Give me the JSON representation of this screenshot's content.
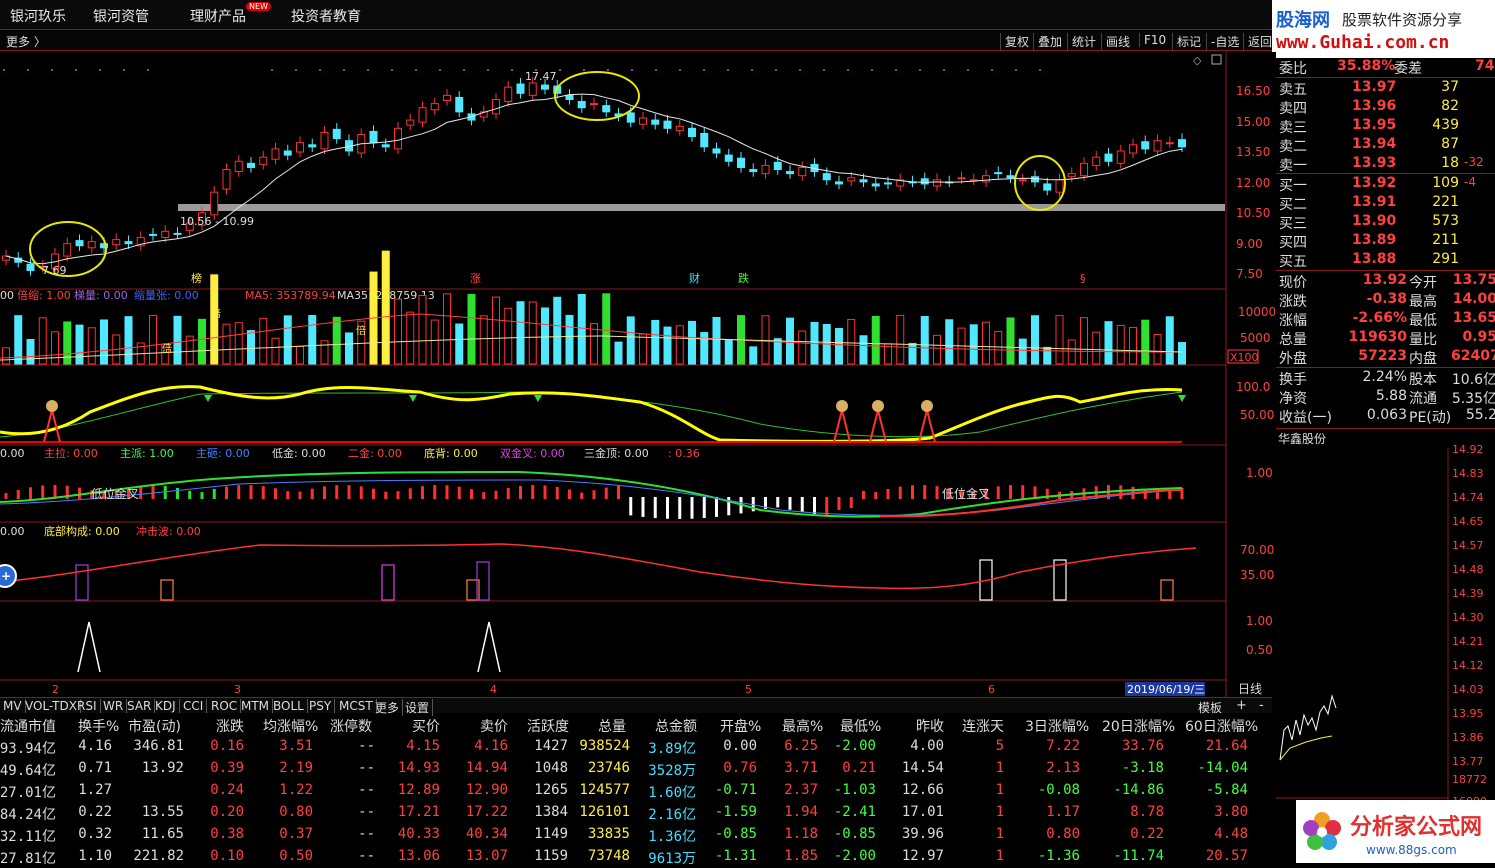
{
  "nav": {
    "items": [
      "银河玖乐",
      "银河资管",
      "理财产品",
      "投资者教育"
    ],
    "new_badge": "NEW"
  },
  "watermark": {
    "brand": "股海网",
    "slogan": "股票软件资源分享",
    "url": "www.Guhai.com.cn"
  },
  "toolbar": {
    "more": "更多 〉",
    "buttons": [
      "复权",
      "叠加",
      "统计",
      "画线",
      "F10",
      "标记",
      "-自选",
      "返回"
    ]
  },
  "chart": {
    "price_axis": [
      "16.50",
      "15.00",
      "13.50",
      "12.00",
      "10.50",
      "9.00",
      "7.50"
    ],
    "annotations": {
      "high": "17.47",
      "low": "7.69",
      "range": "10.56 - 10.99"
    },
    "event_marks": [
      "榜",
      "涨",
      "财",
      "跌",
      "§"
    ],
    "volume_legend": {
      "prefix": "00",
      "bei_label": "倍缩: 1.00",
      "ti_label": "梯量: 0.00",
      "suo_label": "缩量张: 0.00",
      "ma5": "MA5: 353789.94",
      "ma35": "MA35: 268759.13"
    },
    "volume_axis": [
      "10000",
      "5000",
      "X100"
    ],
    "vol_bar_label": "倍",
    "osc_axis": [
      "100.0",
      "50.00"
    ],
    "ind3_legend": [
      {
        "t": "0.00",
        "c": "#ddd"
      },
      {
        "t": "主拉: 0.00",
        "c": "#ff4040"
      },
      {
        "t": "主派: 1.00",
        "c": "#40ff40"
      },
      {
        "t": "主砸: 0.00",
        "c": "#4080ff"
      },
      {
        "t": "低金: 0.00",
        "c": "#ddd"
      },
      {
        "t": "二金: 0.00",
        "c": "#ff4040"
      },
      {
        "t": "底背: 0.00",
        "c": "#ffee40"
      },
      {
        "t": "双金叉: 0.00",
        "c": "#e040e0"
      },
      {
        "t": "三金顶: 0.00",
        "c": "#ddd"
      },
      {
        "t": ": 0.36",
        "c": "#ff4040"
      }
    ],
    "ind3_axis": [
      "1.00"
    ],
    "ind3_cross": "低位金叉",
    "ind4_legend": [
      {
        "t": "0.00",
        "c": "#ddd"
      },
      {
        "t": "底部构成: 0.00",
        "c": "#ffee40"
      },
      {
        "t": "冲击波: 0.00",
        "c": "#ff4040"
      }
    ],
    "ind4_axis": [
      "70.00",
      "35.00"
    ],
    "ind5_axis": [
      "1.00",
      "0.50"
    ],
    "date_axis": [
      "2",
      "3",
      "4",
      "5",
      "6"
    ],
    "current_date": "2019/06/19/三",
    "period": "日线"
  },
  "quote": {
    "weibi": {
      "label": "委比",
      "value": "35.88%",
      "label2": "委差",
      "value2": "74"
    },
    "asks": [
      {
        "label": "卖五",
        "price": "13.97",
        "vol": "37",
        "chg": ""
      },
      {
        "label": "卖四",
        "price": "13.96",
        "vol": "82",
        "chg": ""
      },
      {
        "label": "卖三",
        "price": "13.95",
        "vol": "439",
        "chg": ""
      },
      {
        "label": "卖二",
        "price": "13.94",
        "vol": "87",
        "chg": ""
      },
      {
        "label": "卖一",
        "price": "13.93",
        "vol": "18",
        "chg": "-32"
      }
    ],
    "bids": [
      {
        "label": "买一",
        "price": "13.92",
        "vol": "109",
        "chg": "-4"
      },
      {
        "label": "买二",
        "price": "13.91",
        "vol": "221",
        "chg": ""
      },
      {
        "label": "买三",
        "price": "13.90",
        "vol": "573",
        "chg": ""
      },
      {
        "label": "买四",
        "price": "13.89",
        "vol": "211",
        "chg": ""
      },
      {
        "label": "买五",
        "price": "13.88",
        "vol": "291",
        "chg": ""
      }
    ],
    "stats": [
      {
        "l1": "现价",
        "v1": "13.92",
        "l2": "今开",
        "v2": "13.75"
      },
      {
        "l1": "涨跌",
        "v1": "-0.38",
        "l2": "最高",
        "v2": "14.00"
      },
      {
        "l1": "涨幅",
        "v1": "-2.66%",
        "l2": "最低",
        "v2": "13.65"
      },
      {
        "l1": "总量",
        "v1": "119630",
        "l2": "量比",
        "v2": "0.95"
      },
      {
        "l1": "外盘",
        "v1": "57223",
        "l2": "内盘",
        "v2": "62407"
      }
    ],
    "stats2": [
      {
        "l1": "换手",
        "v1": "2.24%",
        "l2": "股本",
        "v2": "10.6亿"
      },
      {
        "l1": "净资",
        "v1": "5.88",
        "l2": "流通",
        "v2": "5.35亿"
      },
      {
        "l1": "收益(一)",
        "v1": "0.063",
        "l2": "PE(动)",
        "v2": "55.2"
      }
    ]
  },
  "mini": {
    "title": "华鑫股份",
    "axis": [
      "14.92",
      "14.83",
      "14.74",
      "14.65",
      "14.57",
      "14.48",
      "14.39",
      "14.30",
      "14.21",
      "14.12",
      "14.03",
      "13.95",
      "13.86",
      "13.77"
    ],
    "vol_axis": [
      "18772",
      "16090"
    ]
  },
  "indicator_tabs": [
    "MV",
    "VOL-TDX",
    "RSI",
    "WR",
    "SAR",
    "KDJ",
    "CCI",
    "ROC",
    "MTM",
    "BOLL",
    "PSY",
    "MCST",
    "更多",
    "设置"
  ],
  "table_controls": {
    "template": "模板",
    "plus": "+",
    "minus": "-"
  },
  "table": {
    "headers": [
      "流通市值",
      "换手%",
      "市盈(动)",
      "涨跌",
      "均涨幅%",
      "涨停数",
      "买价",
      "卖价",
      "活跃度",
      "总量",
      "总金额",
      "开盘%",
      "最高%",
      "最低%",
      "昨收",
      "连涨天",
      "3日涨幅%",
      "20日涨幅%",
      "60日涨幅%"
    ],
    "rows": [
      [
        "93.94亿",
        "4.16",
        "346.81",
        "0.16",
        "3.51",
        "--",
        "4.15",
        "4.16",
        "1427",
        "938524",
        "3.89亿",
        "0.00",
        "6.25",
        "-2.00",
        "4.00",
        "5",
        "7.22",
        "33.76",
        "21.64"
      ],
      [
        "49.64亿",
        "0.71",
        "13.92",
        "0.39",
        "2.19",
        "--",
        "14.93",
        "14.94",
        "1048",
        "23746",
        "3528万",
        "0.76",
        "3.71",
        "0.21",
        "14.54",
        "1",
        "2.13",
        "-3.18",
        "-14.04"
      ],
      [
        "27.01亿",
        "1.27",
        "",
        "0.24",
        "1.22",
        "--",
        "12.89",
        "12.90",
        "1265",
        "124577",
        "1.60亿",
        "-0.71",
        "2.37",
        "-1.03",
        "12.66",
        "1",
        "-0.08",
        "-14.86",
        "-5.84"
      ],
      [
        "84.24亿",
        "0.22",
        "13.55",
        "0.20",
        "0.80",
        "--",
        "17.21",
        "17.22",
        "1384",
        "126101",
        "2.16亿",
        "-1.59",
        "1.94",
        "-2.41",
        "17.01",
        "1",
        "1.17",
        "8.78",
        "3.80"
      ],
      [
        "32.11亿",
        "0.32",
        "11.65",
        "0.38",
        "0.37",
        "--",
        "40.33",
        "40.34",
        "1149",
        "33835",
        "1.36亿",
        "-0.85",
        "1.18",
        "-0.85",
        "39.96",
        "1",
        "0.80",
        "0.22",
        "4.48"
      ],
      [
        "27.81亿",
        "1.10",
        "221.82",
        "0.10",
        "0.50",
        "--",
        "13.06",
        "13.07",
        "1159",
        "73748",
        "9613万",
        "-1.31",
        "1.85",
        "-2.00",
        "12.97",
        "1",
        "-1.36",
        "-11.74",
        "20.57"
      ]
    ]
  },
  "footer_logo": {
    "text": "分析家公式网",
    "url": "www.88gs.com"
  }
}
